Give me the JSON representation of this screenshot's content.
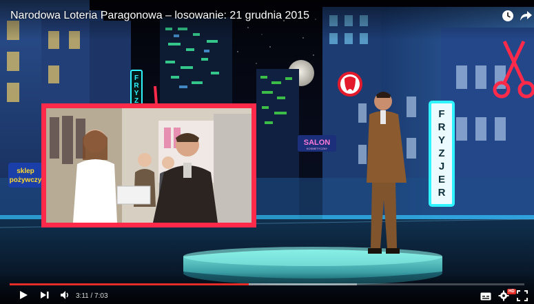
{
  "video": {
    "title": "Narodowa Loteria Paragonowa – losowanie: 21 grudnia 2015"
  },
  "scene_signs": {
    "shop_sign_line1": "sklep",
    "shop_sign_line2": "pożywczy",
    "vertical_sign_left": "FRYZJ",
    "vertical_sign_right": "FRYZJER",
    "salon_sign": "SALON",
    "salon_subtext": "KOSMETYCZNY"
  },
  "player": {
    "progress_fraction": 0.465,
    "buffered_fraction": 0.675,
    "time_current": "3:11",
    "time_separator": " / ",
    "time_total": "7:03",
    "time_text": "3:11 / 7:03",
    "hd_badge": "HD"
  },
  "icons": {
    "watch_later": "clock-icon",
    "share": "share-arrow-icon",
    "play": "play-icon",
    "next": "next-icon",
    "volume": "volume-icon",
    "subtitles": "subtitles-icon",
    "settings": "gear-icon",
    "fullscreen": "fullscreen-icon"
  },
  "colors": {
    "progress_played": "#e52d27",
    "neon_pink": "#ff2a4a",
    "neon_cyan": "#2ff3ff",
    "neon_green": "#5dff3a",
    "sky": "#05070f"
  }
}
